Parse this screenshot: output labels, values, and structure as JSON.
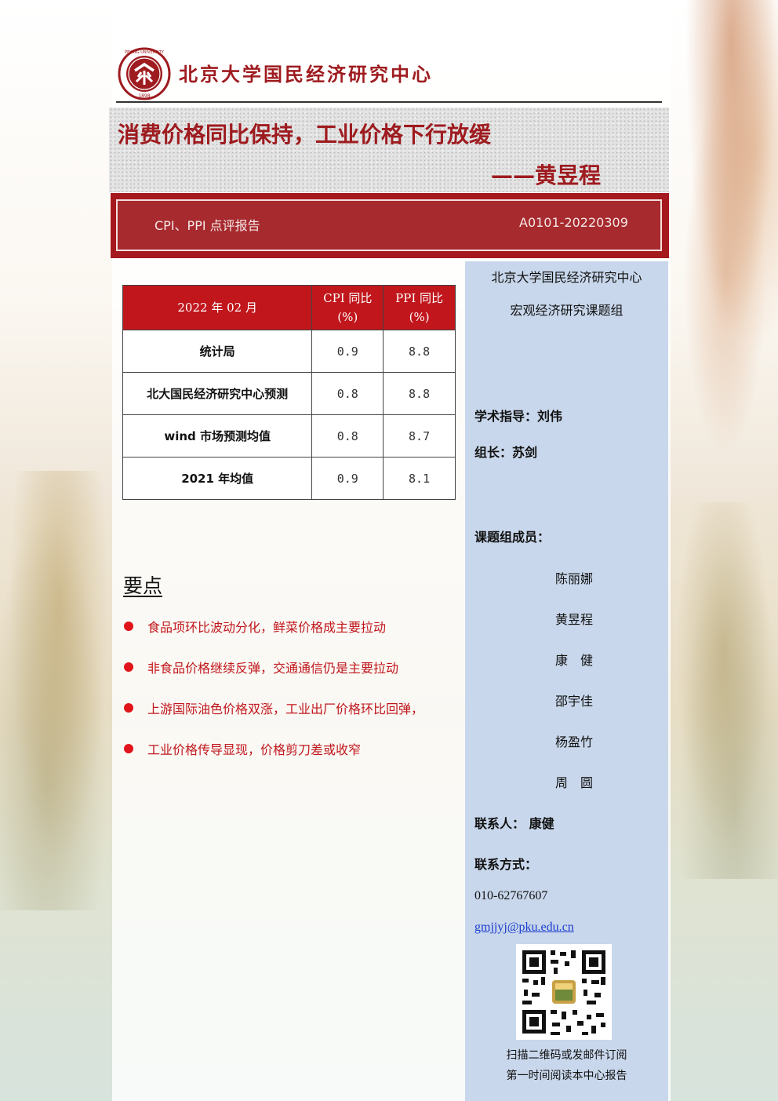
{
  "header": {
    "org_name": "北京大学国民经济研究中心",
    "logo_ring_text": "PEKING UNIVERSITY",
    "logo_year": "1898"
  },
  "title": {
    "main": "消费价格同比保持，工业价格下行放缓",
    "author": "——黄昱程"
  },
  "banner": {
    "report_type": "CPI、PPI 点评报告",
    "report_id": "A0101-20220309"
  },
  "table": {
    "headers": [
      "2022 年 02 月",
      "CPI 同比\n(%)",
      "PPI 同比\n(%)"
    ],
    "header_month": "2022 年 02 月",
    "header_cpi_line1": "CPI 同比",
    "header_cpi_line2": "(%)",
    "header_ppi_line1": "PPI 同比",
    "header_ppi_line2": "(%)",
    "rows": [
      {
        "label": "统计局",
        "cpi": "0.9",
        "ppi": "8.8"
      },
      {
        "label": "北大国民经济研究中心预测",
        "cpi": "0.8",
        "ppi": "8.8"
      },
      {
        "label": "wind 市场预测均值",
        "cpi": "0.8",
        "ppi": "8.7"
      },
      {
        "label": "2021 年均值",
        "cpi": "0.9",
        "ppi": "8.1"
      }
    ]
  },
  "key_points": {
    "title": "要点",
    "items": [
      "食品项环比波动分化，鲜菜价格成主要拉动",
      "非食品价格继续反弹，交通通信仍是主要拉动",
      "上游国际油色价格双涨，工业出厂价格环比回弹，",
      "工业价格传导显现，价格剪刀差或收窄"
    ]
  },
  "sidebar": {
    "org": "北京大学国民经济研究中心",
    "group": "宏观经济研究课题组",
    "advisor": "学术指导：刘伟",
    "leader": "组长：苏剑",
    "members_title": "课题组成员：",
    "members": [
      "陈丽娜",
      "黄昱程",
      "康　健",
      "邵宇佳",
      "杨盈竹",
      "周　圆"
    ],
    "contact_person": "联系人：  康健",
    "contact_title": "联系方式：",
    "phone": "010-62767607",
    "email": "gmjjyj@pku.edu.cn",
    "qr_caption_1": "扫描二维码或发邮件订阅",
    "qr_caption_2": "第一时间阅读本中心报告"
  },
  "colors": {
    "brand_red": "#9e1b1f",
    "banner_red": "#a5181d",
    "table_header_red": "#c0161c",
    "sidebar_blue": "#c8d7eb",
    "bullet_red": "#e0141a",
    "link_blue": "#1a3ccf"
  }
}
